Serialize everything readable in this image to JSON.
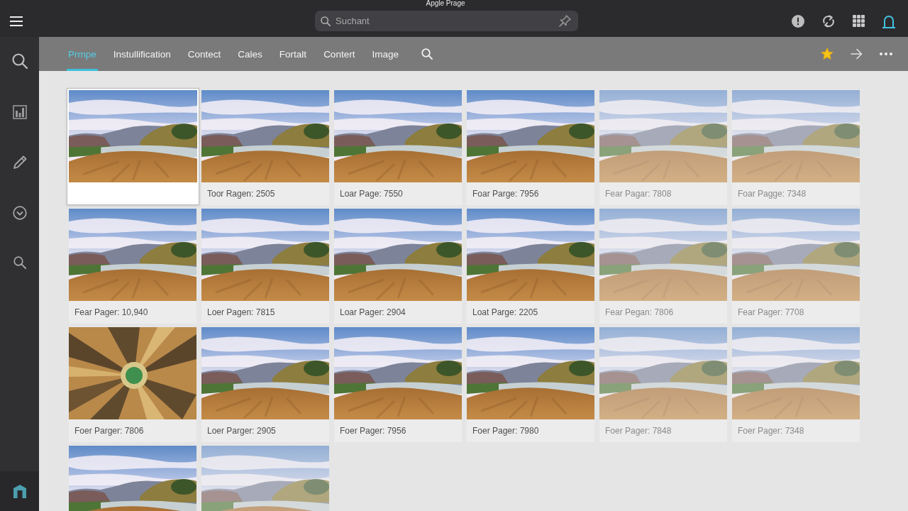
{
  "window": {
    "title": "Apgle Prage"
  },
  "search": {
    "placeholder": "Suchant"
  },
  "tabs": [
    {
      "label": "Prmpe",
      "selected": true
    },
    {
      "label": "Instullification",
      "selected": false
    },
    {
      "label": "Contect",
      "selected": false
    },
    {
      "label": "Cales",
      "selected": false
    },
    {
      "label": "Fortalt",
      "selected": false
    },
    {
      "label": "Contert",
      "selected": false
    },
    {
      "label": "Image",
      "selected": false
    }
  ],
  "gallery": {
    "items": [
      {
        "kind": "landscape",
        "selected": true,
        "disabled": false
      },
      {
        "kind": "landscape",
        "caption": "Toor Ragen: 2505",
        "selected": false,
        "disabled": false
      },
      {
        "kind": "landscape",
        "caption": "Loar Page: 7550",
        "selected": false,
        "disabled": false
      },
      {
        "kind": "landscape",
        "caption": "Foar Parge: 7956",
        "selected": false,
        "disabled": false
      },
      {
        "kind": "landscape",
        "caption": "Fear Pagar: 7808",
        "selected": false,
        "disabled": true
      },
      {
        "kind": "landscape",
        "caption": "Foar Pagge: 7348",
        "selected": false,
        "disabled": true
      },
      {
        "kind": "landscape",
        "caption": "Fear Pager: 10,940",
        "selected": false,
        "disabled": false
      },
      {
        "kind": "landscape",
        "caption": "Loer Pagen: 7815",
        "selected": false,
        "disabled": false
      },
      {
        "kind": "landscape",
        "caption": "Loar Pager: 2904",
        "selected": false,
        "disabled": false
      },
      {
        "kind": "landscape",
        "caption": "Loat Parge: 2205",
        "selected": false,
        "disabled": false
      },
      {
        "kind": "landscape",
        "caption": "Fear Pegan: 7806",
        "selected": false,
        "disabled": true
      },
      {
        "kind": "landscape",
        "caption": "Fear Pager: 7708",
        "selected": false,
        "disabled": true
      },
      {
        "kind": "abstract",
        "caption": "Foer Parger: 7806",
        "selected": false,
        "disabled": false
      },
      {
        "kind": "landscape",
        "caption": "Loer Parger: 2905",
        "selected": false,
        "disabled": false
      },
      {
        "kind": "landscape",
        "caption": "Foer Pager: 7956",
        "selected": false,
        "disabled": false
      },
      {
        "kind": "landscape",
        "caption": "Foer Pager: 7980",
        "selected": false,
        "disabled": false
      },
      {
        "kind": "landscape",
        "caption": "Foer Pager: 7848",
        "selected": false,
        "disabled": true
      },
      {
        "kind": "landscape",
        "caption": "Foer Pager: 7348",
        "selected": false,
        "disabled": true
      },
      {
        "kind": "landscape",
        "selected": false,
        "disabled": false
      },
      {
        "kind": "landscape",
        "selected": false,
        "disabled": true
      }
    ]
  }
}
